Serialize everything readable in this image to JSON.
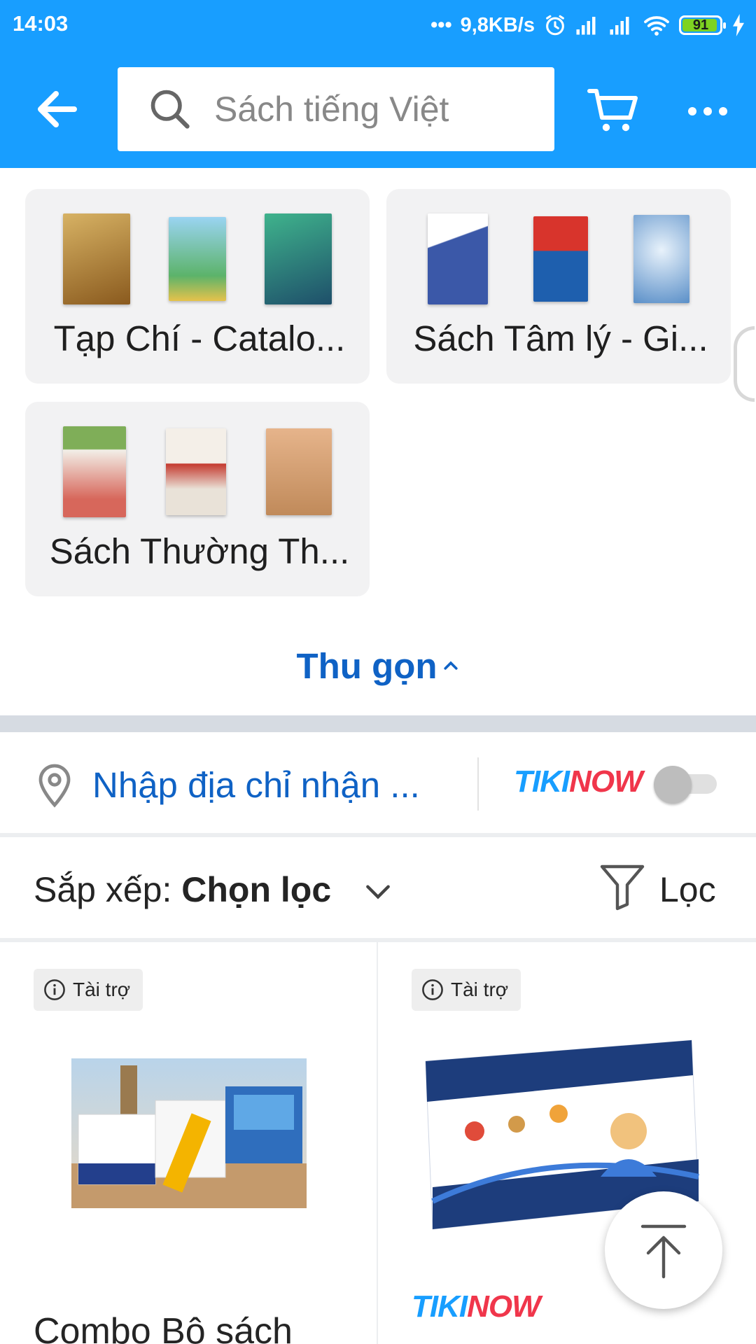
{
  "status_bar": {
    "time": "14:03",
    "network_speed": "9,8KB/s",
    "battery": "91",
    "icons": [
      "alarm-icon",
      "signal-icon",
      "signal-icon",
      "wifi-icon",
      "battery-icon",
      "charging-icon"
    ]
  },
  "header": {
    "search_placeholder": "Sách tiếng Việt",
    "icons": [
      "back-arrow-icon",
      "search-icon",
      "cart-icon",
      "more-dots-icon"
    ]
  },
  "categories": [
    {
      "label": "Tạp Chí - Catalo...",
      "books": [
        "#c79a4a",
        "#5cb36a",
        "#2d6c8a"
      ]
    },
    {
      "label": "Sách Tâm lý - Gi...",
      "books": [
        "#3b58a8",
        "#1e5fae",
        "#5a8fc8"
      ]
    },
    {
      "label": "Sách Thường Th...",
      "books": [
        "#7fae58",
        "#e9e2d8",
        "#c08a5a"
      ]
    }
  ],
  "collapse_label": "Thu gọn",
  "address": {
    "placeholder": "Nhập địa chỉ nhận ...",
    "tikinow_a": "TIKI",
    "tikinow_b": "NOW",
    "toggle_on": false
  },
  "sort": {
    "prefix": "Sắp xếp: ",
    "value": "Chọn lọc",
    "filter_label": "Lọc"
  },
  "products": [
    {
      "badge": "Tài trợ",
      "name": "Combo Bộ sách"
    },
    {
      "badge": "Tài trợ",
      "tikinow_a": "TIKI",
      "tikinow_b": "NOW"
    }
  ],
  "colors": {
    "brand_blue": "#189eff",
    "link_blue": "#0f62c5",
    "tikinow_red": "#f0364b"
  }
}
